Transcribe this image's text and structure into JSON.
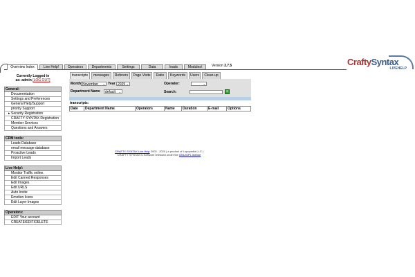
{
  "top_tabs": [
    "Overview Index",
    "Live Help!",
    "Operators",
    "Departments",
    "Settings",
    "Data",
    "leads",
    "Modules/"
  ],
  "version": {
    "prefix": "Version ",
    "number": "3.7.5"
  },
  "logo": {
    "crafty": "Crafty",
    "syntax": "Syntax",
    "sub": "LIVEHELP"
  },
  "login": {
    "line1": "Currently Logged in",
    "line2": "as: admin",
    "logout": "[LOG OUT]"
  },
  "sidebar": {
    "general": {
      "title": "General:",
      "items": [
        "Documentation",
        "Settings and Preferences",
        "General Help/Support",
        "priority Support",
        "Security Registration",
        "CRAFTY SYNTAX Registration",
        "Member Services",
        "Questions and Answers"
      ]
    },
    "crm": {
      "title": "CRM tools:",
      "items": [
        "Leads Database",
        "email message database",
        "Proactive Leads",
        "Import Leads"
      ]
    },
    "livehelp": {
      "title": "Live Help!:",
      "items": [
        "Monitor Traffic online.",
        "Edit Canned Responses",
        "Edit Images",
        "Edit URLS",
        "Auto Invite",
        "Emotion Icons",
        "Edit Layer Images"
      ]
    },
    "operators": {
      "title": "Operators:",
      "items": [
        "EDIT Your account",
        "CREATE/EDIT/DELETE"
      ]
    }
  },
  "sub_tabs": [
    "transcripts",
    "messages",
    "Referers",
    "Page Visits",
    "Ratio",
    "Keywords",
    "Users",
    "Clean-up"
  ],
  "filters": {
    "month_label": "Month",
    "month_value": "November",
    "year_label": "Year",
    "year_value": "2025",
    "operator_label": "Operator:",
    "operator_value": "",
    "department_label": "Department Name",
    "department_value": "default",
    "search_label": "Search:"
  },
  "transcripts_label": "transcripts:",
  "table_headers": [
    "Date",
    "Department Name",
    "Operators",
    "Name",
    "Duration",
    "E-mail",
    "Options"
  ],
  "footer": {
    "link1": "CRAFTY SYNTAX Live Help",
    "text1": " 2003 - 2020 | a product of Lupopedia LLC |",
    "text2": "CRAFTY SYNTAX is Software released under the ",
    "link2": "GNU/GPL license"
  }
}
